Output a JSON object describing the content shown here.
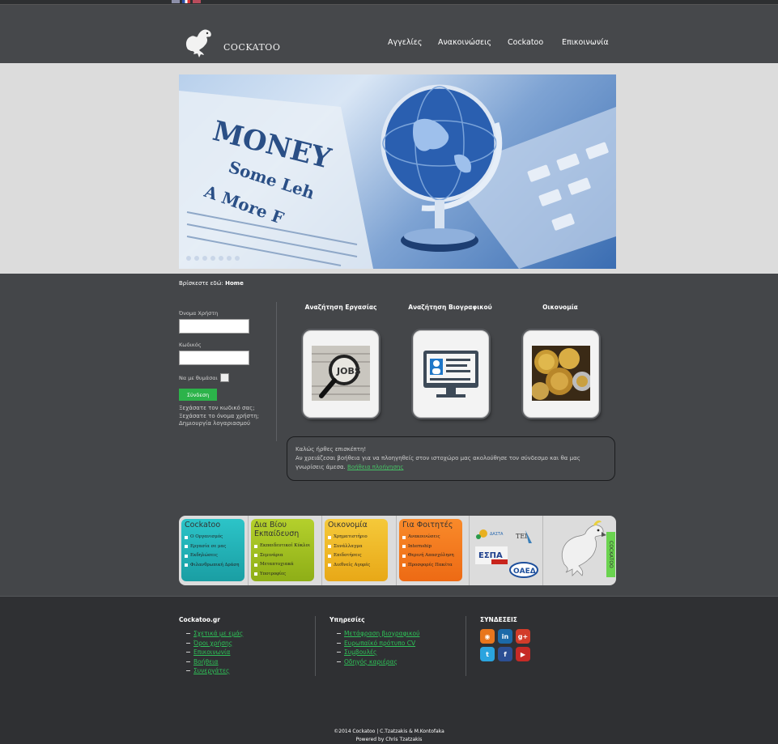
{
  "nav": {
    "brand": "COCKATOO",
    "items": [
      "Αγγελίες",
      "Ανακοινώσεις",
      "Cockatoo",
      "Επικοινωνία"
    ]
  },
  "breadcrumb": {
    "prefix": "Βρίσκεστε εδώ:",
    "current": "Home"
  },
  "login": {
    "username_label": "Όνομα Χρήστη",
    "password_label": "Κωδικός",
    "remember_label": "Να με θυμάσαι",
    "submit_label": "Σύνδεση",
    "links": [
      "Ξεχάσατε τον κωδικό σας;",
      "Ξεχάσατε το όνομα χρήστη;",
      "Δημιουργία λογαριασμού"
    ]
  },
  "tiles": [
    {
      "title": "Αναζήτηση Εργασίας",
      "icon": "jobs-magnifier-icon"
    },
    {
      "title": "Αναζήτηση Βιογραφικού",
      "icon": "cv-monitor-icon"
    },
    {
      "title": "Οικονομία",
      "icon": "coins-icon"
    }
  ],
  "welcome": {
    "line1": "Καλώς ήρθες επισκέπτη!",
    "line2": "Αν χρειάζεσαι βοήθεια για να πλοηγηθείς στον ιστοχώρο μας ακολούθησε τον σύνδεσμο και θα μας γνωρίσεις άμεσα.",
    "link": "Βοήθεια πλοήγησης"
  },
  "banner": {
    "cards": [
      {
        "title": "Cockatoo",
        "color": "#1fb3b8",
        "items": [
          "Ο Οργανισμός",
          "Εργασία σε μας",
          "Εκδηλώσεις",
          "Φιλανθρωπική Δράση"
        ]
      },
      {
        "title": "Δια Βίου Εκπαίδευση",
        "color": "#a2c11f",
        "items": [
          "Εκπαιδευτικοί Κύκλοι",
          "Σεμινάρια",
          "Μεταπτυχιακά",
          "Υποτροφίες"
        ]
      },
      {
        "title": "Οικονομία",
        "color": "#efb81f",
        "items": [
          "Χρηματιστήριο",
          "Συνάλλαγμα",
          "Επιδοτήσεις",
          "Διεθνείς Αγορές"
        ]
      },
      {
        "title": "Για Φοιτητές",
        "color": "#f37a1f",
        "items": [
          "Ανακοινώσεις",
          "Internship",
          "Θερινή Απασχόληση",
          "Προσφορές Πακέτα"
        ]
      }
    ],
    "partners": [
      "ΔΑΣΤΑ",
      "ΤΕΙ",
      "ΕΣΠΑ",
      "ΟΑΕΔ"
    ],
    "side_label": "COCKATOO"
  },
  "footer": {
    "col1": {
      "heading": "Cockatoo.gr",
      "links": [
        "Σχετικά με εμάς",
        "Όροι χρήσης",
        "Επικοινωνία",
        "Βοήθεια",
        "Συνεργάτες"
      ]
    },
    "col2": {
      "heading": "Υπηρεσίες",
      "links": [
        "Μετάφραση βιογραφικού",
        "Ευρωπαϊκό πρότυπο CV",
        "Συμβουλές",
        "Οδηγός καριέρας"
      ]
    },
    "col3": {
      "heading": "ΣΥΝΔΕΣΕΙΣ"
    },
    "social": [
      {
        "name": "rss-icon",
        "glyph": "◉",
        "color": "#e8761d"
      },
      {
        "name": "linkedin-icon",
        "glyph": "in",
        "color": "#1c6aa8"
      },
      {
        "name": "googleplus-icon",
        "glyph": "g+",
        "color": "#d23c2a"
      },
      {
        "name": "twitter-icon",
        "glyph": "t",
        "color": "#2aa4df"
      },
      {
        "name": "facebook-icon",
        "glyph": "f",
        "color": "#2c4f94"
      },
      {
        "name": "youtube-icon",
        "glyph": "▶",
        "color": "#c62a26"
      }
    ],
    "copyright": "©2014 Cockatoo | C.Tzatzakis & M.Kontofaka",
    "powered": "Powered by Chris Tzatzakis"
  }
}
